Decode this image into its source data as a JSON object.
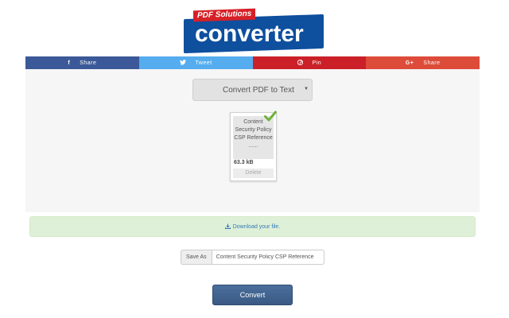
{
  "logo": {
    "tag": "PDF Solutions",
    "text": "converter",
    "colors": {
      "banner": "#0e4f9e",
      "tag": "#d62027"
    }
  },
  "share": [
    {
      "label": "Share",
      "icon": "f",
      "icon_name": "facebook-icon",
      "color": "#3b5998"
    },
    {
      "label": "Tweet",
      "icon": "🐦",
      "icon_name": "twitter-icon",
      "color": "#55acee"
    },
    {
      "label": "Pin",
      "icon": "℗",
      "icon_name": "pinterest-icon",
      "color": "#cb2027"
    },
    {
      "label": "Share",
      "icon": "G+",
      "icon_name": "google-plus-icon",
      "color": "#dd4b39"
    }
  ],
  "converter": {
    "selected": "Convert PDF to Text"
  },
  "file": {
    "name": "Content Security Policy CSP Reference ......",
    "size": "63.3 kB",
    "delete_label": "Delete"
  },
  "download": {
    "label": "Download your file."
  },
  "save_as": {
    "label": "Save As",
    "value": "Content Security Policy CSP Reference"
  },
  "convert_label": "Convert"
}
